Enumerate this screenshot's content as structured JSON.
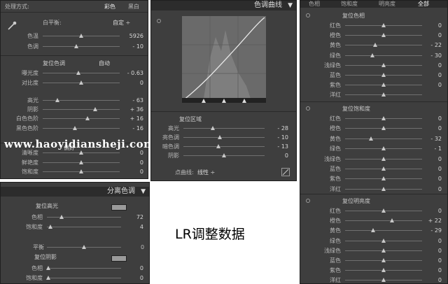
{
  "watermark": "www.haoyidiansheji.com",
  "caption": "LR调整数据",
  "basic": {
    "treatment_label": "处理方式:",
    "treatment_color": "彩色",
    "treatment_bw": "黑白",
    "wb_label": "白平衡:",
    "wb_value": "自定 ÷",
    "tone_title": "复位色调",
    "auto_label": "自动",
    "presence_title": "偏好",
    "sliders": [
      {
        "label": "色温",
        "value": "5926",
        "pos": 0.5
      },
      {
        "label": "色调",
        "value": "- 10",
        "pos": 0.44
      },
      {
        "label": "曝光度",
        "value": "- 0.63",
        "pos": 0.46
      },
      {
        "label": "对比度",
        "value": "0",
        "pos": 0.5
      },
      {
        "label": "高光",
        "value": "- 63",
        "pos": 0.19
      },
      {
        "label": "阴影",
        "value": "+ 36",
        "pos": 0.68
      },
      {
        "label": "白色色阶",
        "value": "+ 16",
        "pos": 0.58
      },
      {
        "label": "黑色色阶",
        "value": "- 16",
        "pos": 0.42
      },
      {
        "label": "清晰度",
        "value": "0",
        "pos": 0.5
      },
      {
        "label": "鲜艳度",
        "value": "0",
        "pos": 0.5
      },
      {
        "label": "饱和度",
        "value": "0",
        "pos": 0.5
      }
    ]
  },
  "curve": {
    "title": "色调曲线",
    "region_title": "复位区域",
    "sliders": [
      {
        "label": "高光",
        "value": "- 28",
        "pos": 0.36
      },
      {
        "label": "亮色调",
        "value": "- 10",
        "pos": 0.45
      },
      {
        "label": "暗色调",
        "value": "- 13",
        "pos": 0.43
      },
      {
        "label": "阴影",
        "value": "0",
        "pos": 0.5
      }
    ],
    "point_curve_label": "点曲线:",
    "point_curve_value": "线性 ÷"
  },
  "split": {
    "title": "分离色调",
    "highlight_title": "复位高光",
    "shadow_title": "复位阴影",
    "balance_label": "平衡",
    "balance_value": "0",
    "sliders_high": [
      {
        "label": "色相",
        "value": "72",
        "pos": 0.2
      },
      {
        "label": "饱和度",
        "value": "4",
        "pos": 0.05
      }
    ],
    "sliders_shadow": [
      {
        "label": "色相",
        "value": "0",
        "pos": 0.02
      },
      {
        "label": "饱和度",
        "value": "0",
        "pos": 0.02
      }
    ]
  },
  "hsl": {
    "tabs": [
      "色相",
      "饱和度",
      "明亮度",
      "全部"
    ],
    "hue_title": "复位色相",
    "sat_title": "复位饱和度",
    "lum_title": "复位明亮度",
    "hue": [
      {
        "label": "红色",
        "value": "0",
        "pos": 0.5
      },
      {
        "label": "橙色",
        "value": "0",
        "pos": 0.5
      },
      {
        "label": "黄色",
        "value": "- 22",
        "pos": 0.39
      },
      {
        "label": "绿色",
        "value": "- 30",
        "pos": 0.35
      },
      {
        "label": "浅绿色",
        "value": "0",
        "pos": 0.5
      },
      {
        "label": "蓝色",
        "value": "0",
        "pos": 0.5
      },
      {
        "label": "紫色",
        "value": "0",
        "pos": 0.5
      },
      {
        "label": "洋红",
        "value": "",
        "pos": 0.5
      }
    ],
    "sat": [
      {
        "label": "红色",
        "value": "0",
        "pos": 0.5
      },
      {
        "label": "橙色",
        "value": "0",
        "pos": 0.5
      },
      {
        "label": "黄色",
        "value": "- 32",
        "pos": 0.34
      },
      {
        "label": "绿色",
        "value": "- 1",
        "pos": 0.5
      },
      {
        "label": "浅绿色",
        "value": "0",
        "pos": 0.5
      },
      {
        "label": "蓝色",
        "value": "0",
        "pos": 0.5
      },
      {
        "label": "紫色",
        "value": "0",
        "pos": 0.5
      },
      {
        "label": "洋红",
        "value": "0",
        "pos": 0.5
      }
    ],
    "lum": [
      {
        "label": "红色",
        "value": "0",
        "pos": 0.5
      },
      {
        "label": "橙色",
        "value": "+ 22",
        "pos": 0.61
      },
      {
        "label": "黄色",
        "value": "- 29",
        "pos": 0.36
      },
      {
        "label": "绿色",
        "value": "0",
        "pos": 0.5
      },
      {
        "label": "浅绿色",
        "value": "0",
        "pos": 0.5
      },
      {
        "label": "蓝色",
        "value": "0",
        "pos": 0.5
      },
      {
        "label": "紫色",
        "value": "0",
        "pos": 0.5
      },
      {
        "label": "洋红",
        "value": "0",
        "pos": 0.5
      }
    ]
  }
}
